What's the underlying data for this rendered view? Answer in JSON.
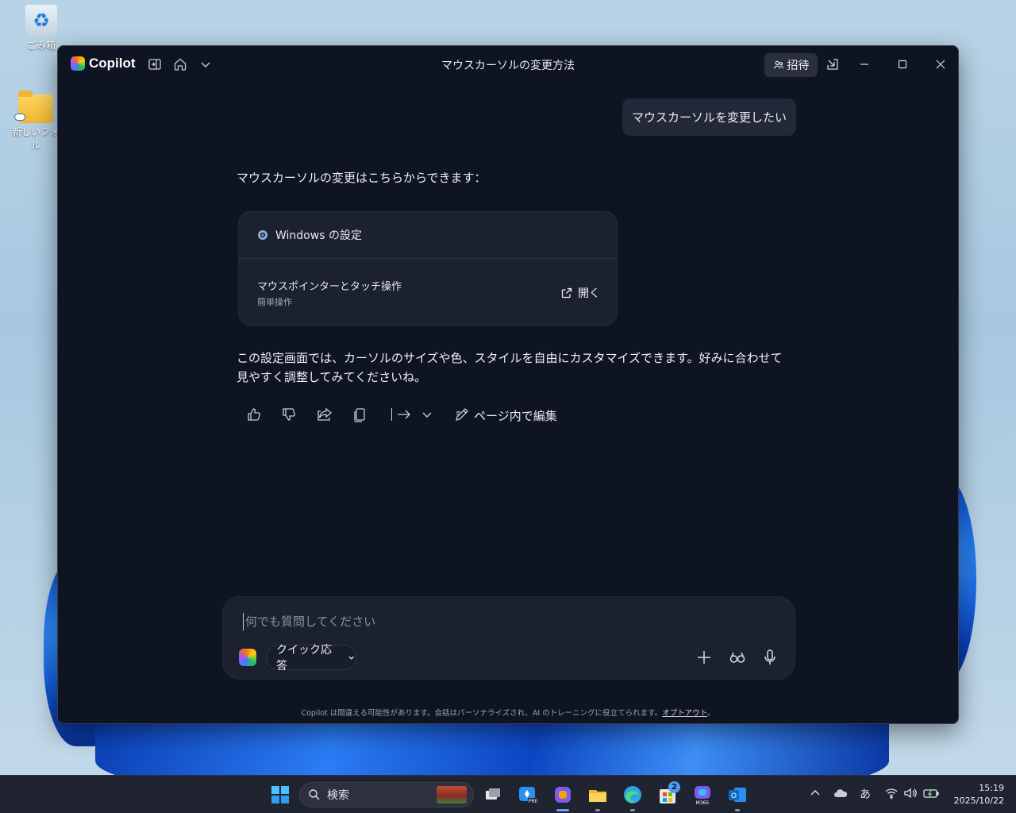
{
  "desktop": {
    "icons": [
      {
        "label": "ごみ箱"
      },
      {
        "label": "新しいフォル"
      }
    ]
  },
  "app": {
    "name": "Copilot",
    "window_title": "マウスカーソルの変更方法",
    "invite_label": "招待"
  },
  "chat": {
    "user_message": "マウスカーソルを変更したい",
    "ai_intro": "マウスカーソルの変更はこちらからできます：",
    "card": {
      "header": "Windows の設定",
      "item_title": "マウスポインターとタッチ操作",
      "item_subtitle": "簡単操作",
      "open_label": "開く"
    },
    "ai_followup": "この設定画面では、カーソルのサイズや色、スタイルを自由にカスタマイズできます。好みに合わせて見やすく調整してみてくださいね。",
    "actions": {
      "edit_label": "ページ内で編集"
    }
  },
  "composer": {
    "placeholder": "何でも質問してください",
    "mode_label": "クイック応答"
  },
  "footer": {
    "disclaimer": "Copilot は間違える可能性があります。会話はパーソナライズされ、AI のトレーニングに役立てられます。",
    "optout": "オプトアウト",
    "end": "。"
  },
  "taskbar": {
    "search_label": "検索",
    "store_badge": "2",
    "ime": "あ",
    "time": "15:19",
    "date": "2025/10/22"
  },
  "colors": {
    "window_bg": "#0f1422",
    "card_bg": "#1c2130",
    "accent": "#60a5fa"
  }
}
